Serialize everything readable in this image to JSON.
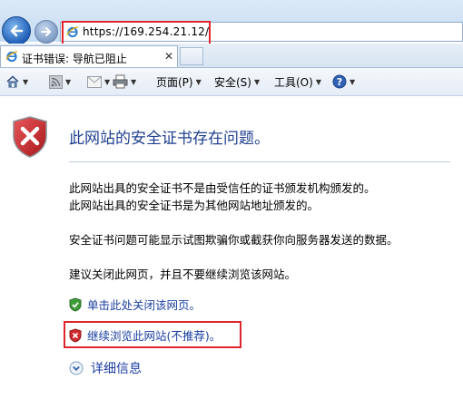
{
  "address_bar": {
    "url": "https://169.254.21.12/"
  },
  "tab": {
    "title": "证书错误: 导航已阻止",
    "close": "✕"
  },
  "command_bar": {
    "page": "页面(P)",
    "safety": "安全(S)",
    "tools": "工具(O)"
  },
  "content": {
    "title": "此网站的安全证书存在问题。",
    "para1_line1": "此网站出具的安全证书不是由受信任的证书颁发机构颁发的。",
    "para1_line2": "此网站出具的安全证书是为其他网站地址颁发的。",
    "para2": "安全证书问题可能显示试图欺骗你或截获你向服务器发送的数据。",
    "para3": "建议关闭此网页，并且不要继续浏览该网站。",
    "close_link": "单击此处关闭该网页。",
    "continue_link": "继续浏览此网站(不推荐)。",
    "details_link": "详细信息"
  },
  "colors": {
    "highlight_border": "#e0242d",
    "link": "#1b3fa0",
    "title": "#1f3f8f"
  }
}
